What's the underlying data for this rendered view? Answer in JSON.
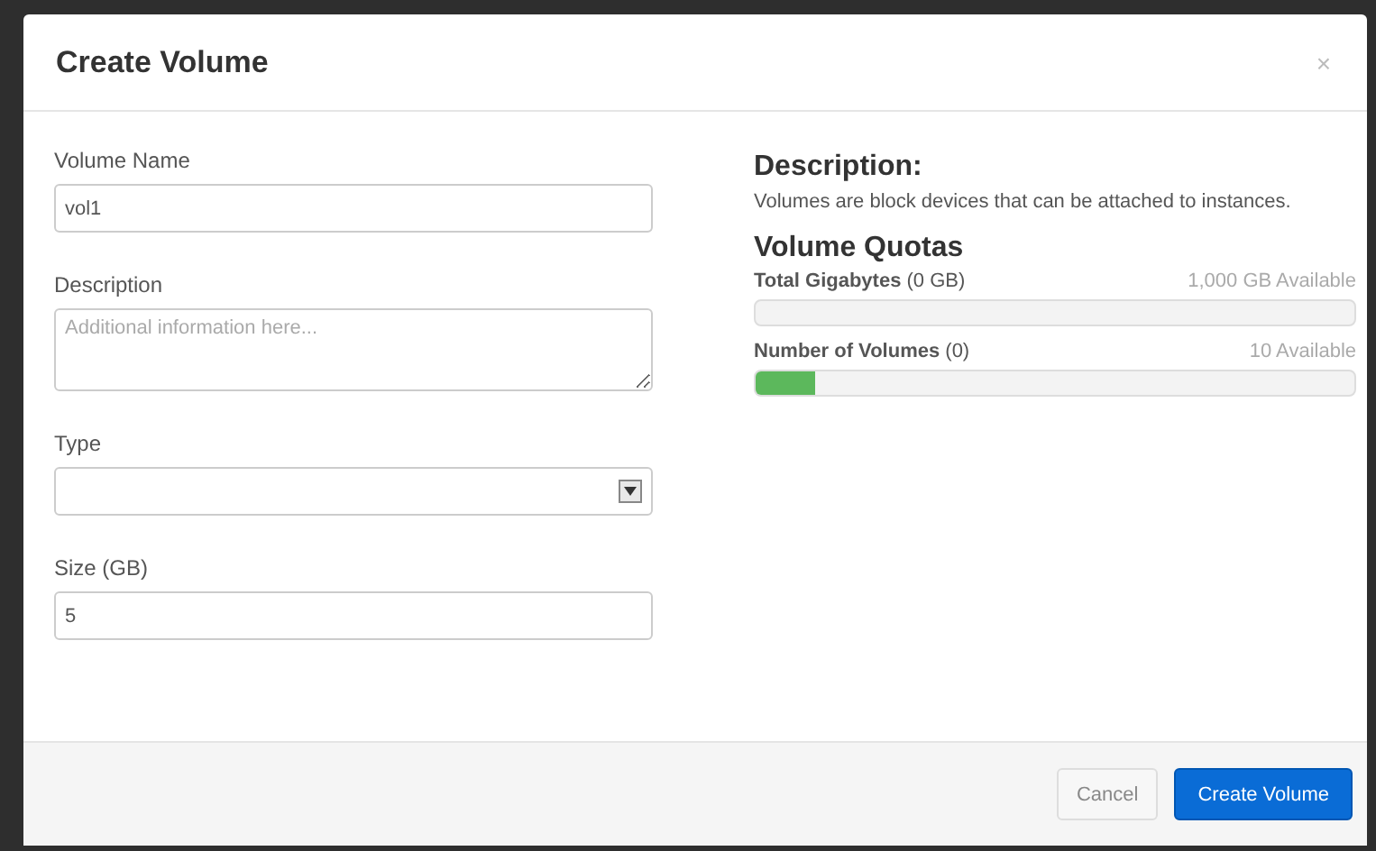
{
  "dialog": {
    "title": "Create Volume",
    "close": "×"
  },
  "form": {
    "fields": [
      {
        "kind": "text",
        "label": "Volume Name",
        "value": "vol1"
      },
      {
        "kind": "textarea",
        "label": "Description",
        "placeholder": "Additional information here..."
      },
      {
        "kind": "select",
        "label": "Type"
      },
      {
        "kind": "text",
        "label": "Size (GB)",
        "value": "5"
      }
    ]
  },
  "info": {
    "heading": "Description:",
    "text": "Volumes are block devices that can be attached to instances."
  },
  "quotas": {
    "heading": "Volume Quotas",
    "items": [
      {
        "label": "**Total Gigabytes** (0 GB)",
        "available": "1,000 GB Available",
        "level": 0
      },
      {
        "label": "**Number of Volumes** (0)",
        "available": "10 Available",
        "level": 0.1
      }
    ]
  },
  "buttons": [
    {
      "label": "Cancel",
      "kind": "secondary"
    },
    {
      "label": "Create Volume",
      "kind": "primary"
    }
  ]
}
